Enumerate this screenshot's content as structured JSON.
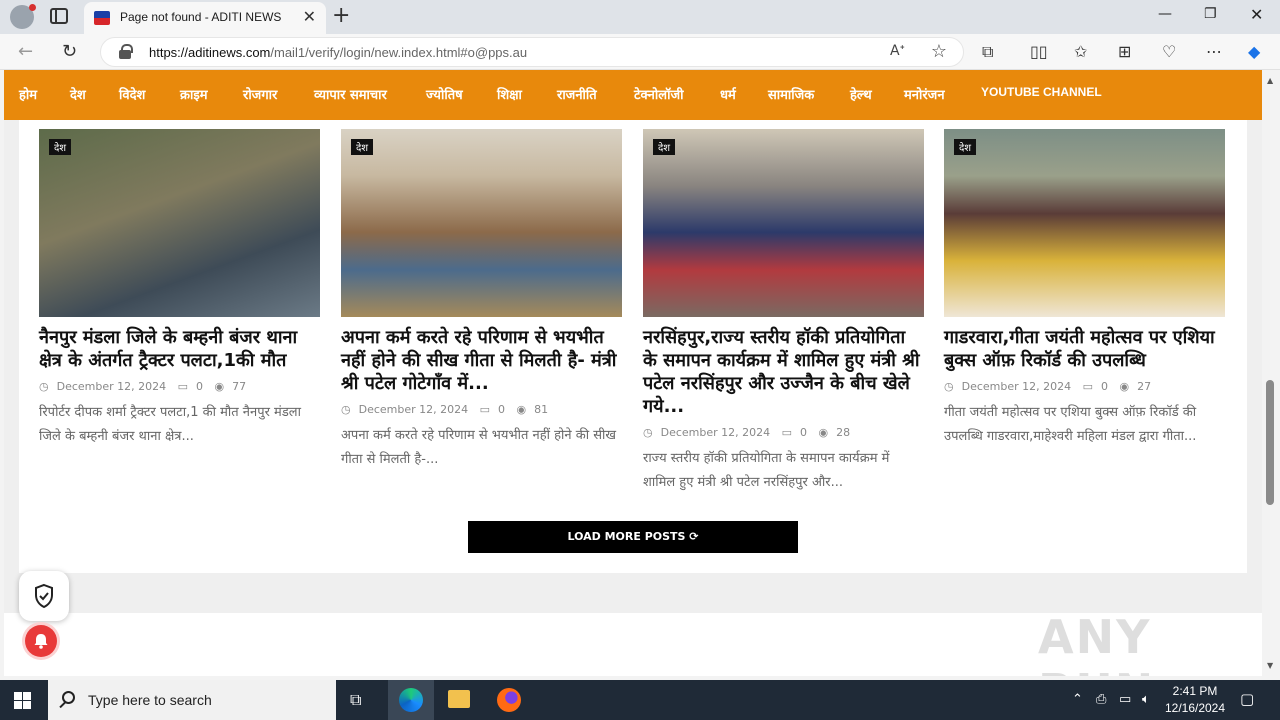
{
  "browser": {
    "tab_title": "Page not found - ADITI NEWS",
    "url_host": "https://aditinews.com",
    "url_path": "/mail1/verify/login/new.index.html#o@pps.au"
  },
  "nav": [
    "होम",
    "देश",
    "विदेश",
    "क्राइम",
    "रोजगार",
    "व्यापार समाचार",
    "ज्योतिष",
    "शिक्षा",
    "राजनीति",
    "टेक्नोलॉजी",
    "धर्म",
    "सामाजिक",
    "हेल्थ",
    "मनोरंजन",
    "YOUTUBE CHANNEL"
  ],
  "posts": [
    {
      "tag": "देश",
      "title": "नैनपुर मंडला जिले के बम्हनी बंजर थाना क्षेत्र के अंतर्गत ट्रैक्टर पलटा,1की मौत",
      "date": "December 12, 2024",
      "comments": "0",
      "views": "77",
      "excerpt": "रिपोर्टर दीपक शर्मा ट्रैक्टर पलटा,1 की मौत नैनपुर मंडला जिले के बम्हनी बंजर थाना क्षेत्र...",
      "image_color": "#6e6a55"
    },
    {
      "tag": "देश",
      "title": "अपना कर्म करते रहे परिणाम से भयभीत नहीं होने की सीख गीता से मिलती है- मंत्री श्री पटेल गोटेगाँव में...",
      "date": "December 12, 2024",
      "comments": "0",
      "views": "81",
      "excerpt": "अपना कर्म करते रहे परिणाम से भयभीत नहीं होने की सीख गीता से मिलती है-...",
      "image_color": "#9a7b58"
    },
    {
      "tag": "देश",
      "title": "नरसिंहपुर,राज्य स्तरीय हॉकी प्रतियोगिता के समापन कार्यक्रम में शामिल हुए मंत्री श्री पटेल नरसिंहपुर और उज्जैन के बीच खेले गये...",
      "date": "December 12, 2024",
      "comments": "0",
      "views": "28",
      "excerpt": "राज्य स्तरीय हॉकी प्रतियोगिता के समापन कार्यक्रम में शामिल हुए मंत्री श्री पटेल नरसिंहपुर और...",
      "image_color": "#7a4a4e"
    },
    {
      "tag": "देश",
      "title": "गाडरवारा,गीता जयंती महोत्सव पर एशिया बुक्स ऑफ़ रिकॉर्ड की उपलब्धि",
      "date": "December 12, 2024",
      "comments": "0",
      "views": "27",
      "excerpt": "गीता जयंती महोत्सव पर एशिया बुक्स ऑफ़ रिकॉर्ड की उपलब्धि गाडरवारा,माहेश्वरी महिला मंडल द्वारा गीता...",
      "image_color": "#b59a5c"
    }
  ],
  "load_more": "LOAD MORE POSTS ⟳",
  "watermark": "ANY RUN",
  "taskbar": {
    "search_placeholder": "Type here to search",
    "time": "2:41 PM",
    "date": "12/16/2024"
  },
  "colors": {
    "nav_bg": "#e8890c",
    "taskbar_bg": "#1f2a37"
  }
}
